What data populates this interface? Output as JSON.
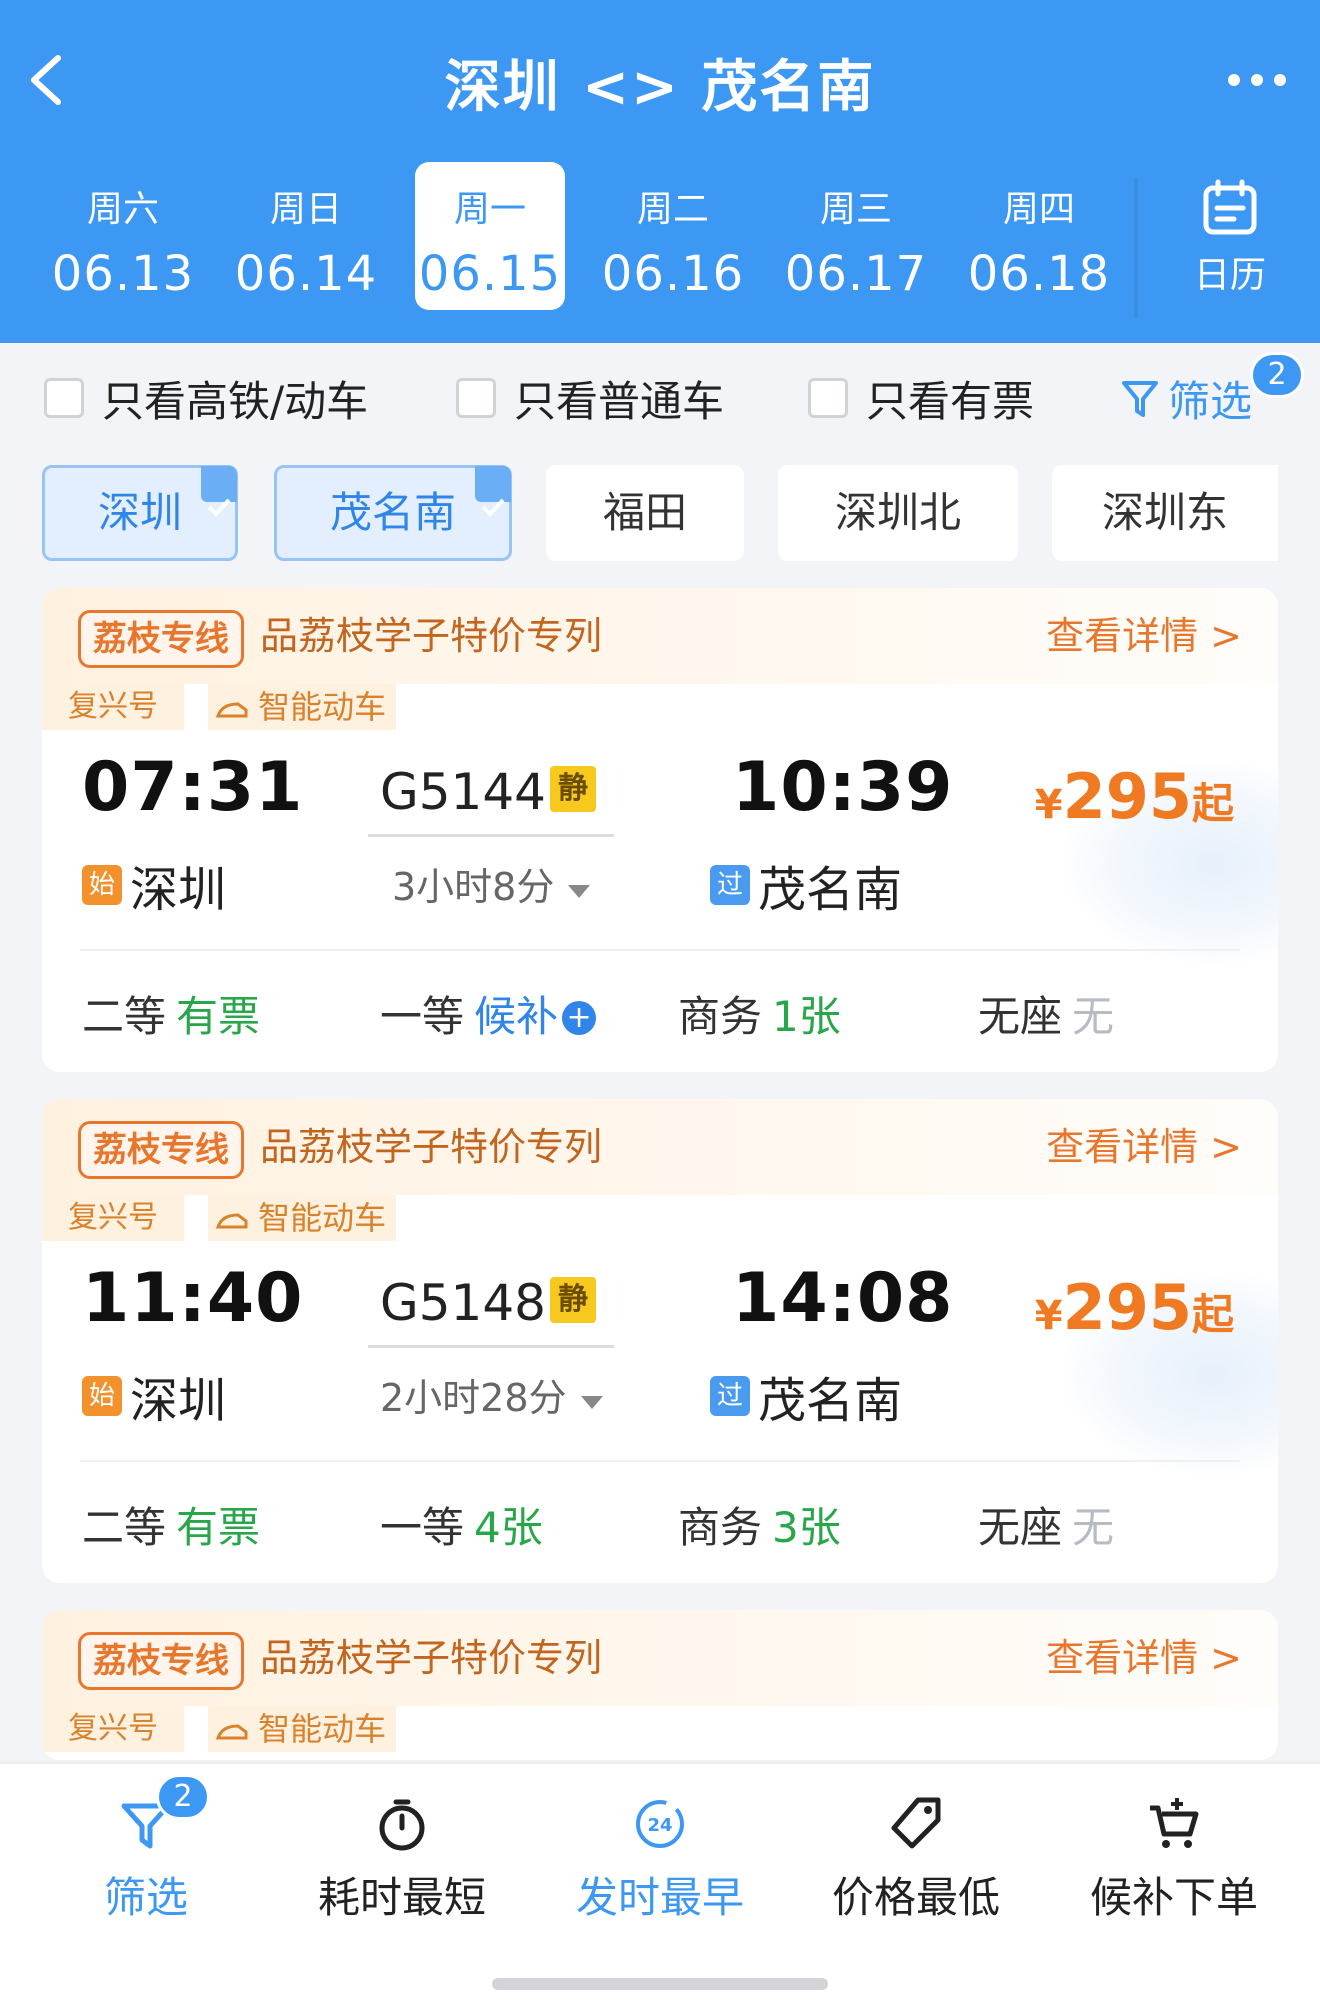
{
  "header": {
    "title": "深圳 <> 茂名南",
    "dates": [
      {
        "dow": "周六",
        "date": "06.13"
      },
      {
        "dow": "周日",
        "date": "06.14"
      },
      {
        "dow": "周一",
        "date": "06.15",
        "active": true
      },
      {
        "dow": "周二",
        "date": "06.16"
      },
      {
        "dow": "周三",
        "date": "06.17"
      },
      {
        "dow": "周四",
        "date": "06.18"
      }
    ],
    "calendar_label": "日历"
  },
  "filters": {
    "gaotie": "只看高铁/动车",
    "putong": "只看普通车",
    "youpiao": "只看有票",
    "screen_label": "筛选",
    "screen_count": "2"
  },
  "stations": [
    {
      "name": "深圳",
      "selected": true
    },
    {
      "name": "茂名南",
      "selected": true
    },
    {
      "name": "福田",
      "selected": false
    },
    {
      "name": "深圳北",
      "selected": false
    },
    {
      "name": "深圳东",
      "selected": false
    }
  ],
  "trains": [
    {
      "promo_tag": "荔枝专线",
      "promo_text": "品荔枝学子特价专列",
      "promo_detail": "查看详情 >",
      "brand": "复兴号",
      "smart": "智能动车",
      "depart_time": "07:31",
      "train_no": "G5144",
      "quiet": "静",
      "duration": "3小时8分",
      "arrive_time": "10:39",
      "from_mark": "始",
      "from": "深圳",
      "to_mark": "过",
      "to": "茂名南",
      "price_symbol": "¥",
      "price": "295",
      "price_suffix": "起",
      "seats": [
        {
          "name": "二等",
          "value": "有票"
        },
        {
          "name": "一等",
          "value": "候补"
        },
        {
          "name": "商务",
          "value": "1张"
        },
        {
          "name": "无座",
          "value": "无"
        }
      ]
    },
    {
      "promo_tag": "荔枝专线",
      "promo_text": "品荔枝学子特价专列",
      "promo_detail": "查看详情 >",
      "brand": "复兴号",
      "smart": "智能动车",
      "depart_time": "11:40",
      "train_no": "G5148",
      "quiet": "静",
      "duration": "2小时28分",
      "arrive_time": "14:08",
      "from_mark": "始",
      "from": "深圳",
      "to_mark": "过",
      "to": "茂名南",
      "price_symbol": "¥",
      "price": "295",
      "price_suffix": "起",
      "seats": [
        {
          "name": "二等",
          "value": "有票"
        },
        {
          "name": "一等",
          "value": "4张"
        },
        {
          "name": "商务",
          "value": "3张"
        },
        {
          "name": "无座",
          "value": "无"
        }
      ]
    },
    {
      "promo_tag": "荔枝专线",
      "promo_text": "品荔枝学子特价专列",
      "promo_detail": "查看详情 >",
      "brand": "复兴号",
      "smart": "智能动车"
    }
  ],
  "tabbar": {
    "filter": "筛选",
    "filter_count": "2",
    "shortest": "耗时最短",
    "earliest": "发时最早",
    "earliest_icon_text": "24",
    "cheapest": "价格最低",
    "waitlist": "候补下单"
  },
  "colors": {
    "primary": "#3d98f3",
    "orange": "#f07a21",
    "green": "#28a74a"
  }
}
